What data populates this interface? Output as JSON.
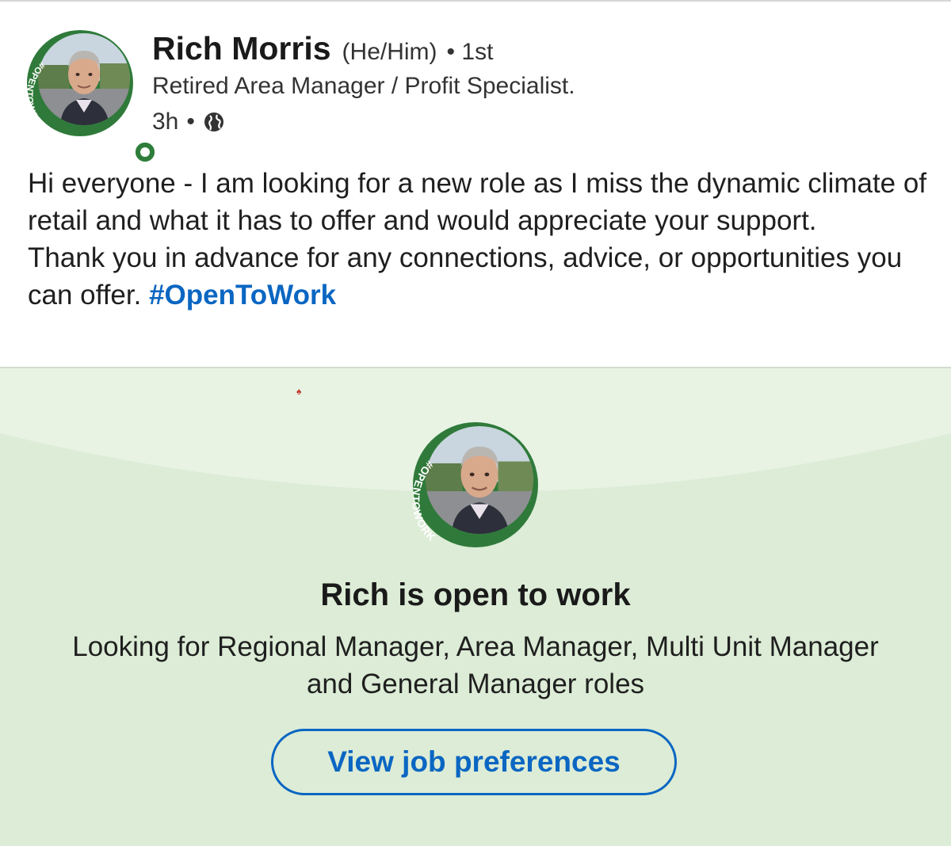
{
  "post": {
    "author": {
      "name": "Rich Morris",
      "pronouns": "(He/Him)",
      "degree": "• 1st",
      "headline": "Retired Area Manager / Profit Specialist.",
      "avatar_badge": "#OPENTOWORK",
      "presence": "online"
    },
    "meta": {
      "time": "3h",
      "separator": "•",
      "visibility_icon": "globe-icon"
    },
    "body": {
      "paragraph_1": "Hi everyone - I am looking for a new role as I miss the dynamic climate of retail and what it has to offer and would appreciate your support.",
      "paragraph_2": "Thank you in advance for any connections, advice, or opportunities you can offer.",
      "hashtag": "#OpenToWork"
    }
  },
  "open_to_work_card": {
    "avatar_badge": "#OPENTOWORK",
    "title": "Rich is open to work",
    "description": "Looking for Regional Manager, Area Manager, Multi Unit Manager and General Manager roles",
    "button_label": "View job preferences"
  },
  "colors": {
    "link_blue": "#0a66c2",
    "badge_green": "#2f7a3a",
    "card_background": "#dcecd6",
    "card_arc": "#e8f3e4"
  }
}
